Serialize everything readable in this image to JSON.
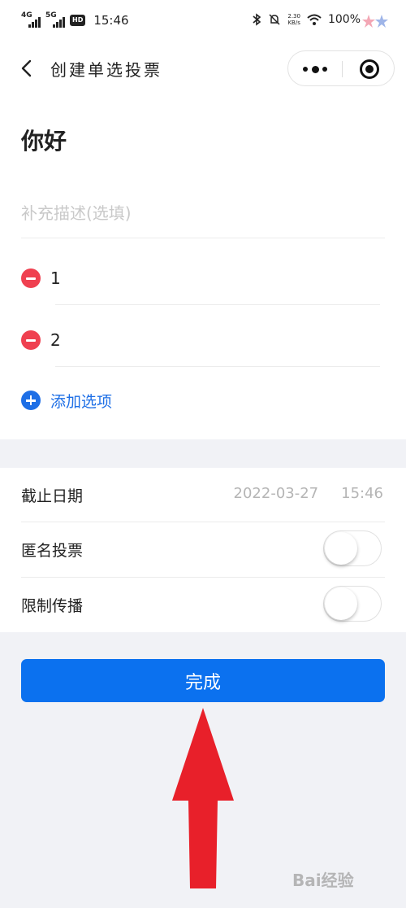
{
  "status_bar": {
    "network_1": "4G",
    "network_2": "5G",
    "hd_badge": "HD",
    "time": "15:46",
    "speed_value": "2.30",
    "speed_unit": "KB/s",
    "battery": "100%"
  },
  "nav": {
    "title": "创建单选投票"
  },
  "form": {
    "title": "你好",
    "description_placeholder": "补充描述(选填)",
    "options": [
      {
        "label": "1"
      },
      {
        "label": "2"
      }
    ],
    "add_option_label": "添加选项"
  },
  "settings": {
    "deadline_label": "截止日期",
    "deadline_date": "2022-03-27",
    "deadline_time": "15:46",
    "anonymous_label": "匿名投票",
    "anonymous_on": false,
    "restrict_label": "限制传播",
    "restrict_on": false
  },
  "actions": {
    "done_label": "完成"
  },
  "watermark": {
    "text": "Bai经验"
  },
  "colors": {
    "primary": "#0b71ef",
    "link": "#1e6fe6",
    "danger": "#ef4050",
    "annotation_arrow": "#e8202a",
    "page_bg": "#f1f2f6"
  }
}
